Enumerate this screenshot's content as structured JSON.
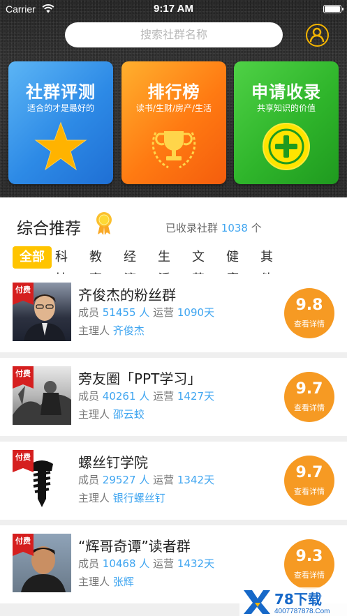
{
  "status_bar": {
    "carrier": "Carrier",
    "time": "9:17 AM"
  },
  "search": {
    "placeholder": "搜索社群名称"
  },
  "feature_cards": [
    {
      "title": "社群评测",
      "subtitle": "适合的才是最好的",
      "icon": "star-icon",
      "color": "#2d8ae6"
    },
    {
      "title": "排行榜",
      "subtitle": "读书/生财/房产/生活",
      "icon": "trophy-icon",
      "color": "#ff7a12"
    },
    {
      "title": "申请收录",
      "subtitle": "共享知识的价值",
      "icon": "plus-circle-icon",
      "color": "#2fb52b"
    }
  ],
  "recommend": {
    "title": "综合推荐",
    "collected_prefix": "已收录社群",
    "collected_count": "1038",
    "collected_suffix": "个"
  },
  "tabs": [
    "全部",
    "科技",
    "教育",
    "经济",
    "生活",
    "文艺",
    "健康",
    "其他"
  ],
  "labels": {
    "paid": "付费",
    "members": "成员",
    "people_unit": "人",
    "operating": "运营",
    "owner": "主理人",
    "details": "查看详情"
  },
  "groups": [
    {
      "name": "齐俊杰的粉丝群",
      "members": "51455",
      "days": "1090天",
      "owner": "齐俊杰",
      "score": "9.8"
    },
    {
      "name": "旁友圈「PPT学习」",
      "members": "40261",
      "days": "1427天",
      "owner": "邵云蛟",
      "score": "9.7"
    },
    {
      "name": "螺丝钉学院",
      "members": "29527",
      "days": "1342天",
      "owner": "银行螺丝钉",
      "score": "9.7"
    },
    {
      "name": "“辉哥奇谭”读者群",
      "members": "10468",
      "days": "1432天",
      "owner": "张辉",
      "score": "9.3"
    }
  ],
  "watermark": {
    "brand": "78下载",
    "url": "4007787878.Com"
  },
  "colors": {
    "accent_blue": "#3fa5f0",
    "score_orange": "#f69a23",
    "tab_active": "#ffc400",
    "paid_red": "#d51f1f"
  }
}
